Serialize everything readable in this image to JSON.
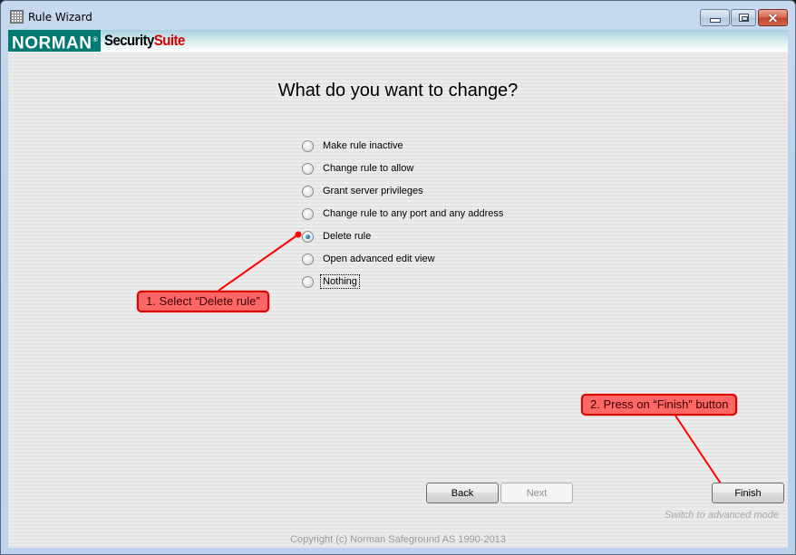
{
  "window": {
    "title": "Rule Wizard",
    "app_icon": "firewall-grid-icon",
    "controls": {
      "minimize": "minimize-icon",
      "maximize": "maximize-icon",
      "close": "close-icon"
    }
  },
  "brand": {
    "name": "NORMAN",
    "registered_mark": "®",
    "product_part1": "Security",
    "product_part2": "Suite",
    "colors": {
      "norman_bg": "#007a73",
      "suite_red": "#d90000"
    }
  },
  "wizard": {
    "title": "What do you want to change?",
    "options": [
      {
        "label": "Make rule inactive",
        "checked": false,
        "focused": false
      },
      {
        "label": "Change rule to allow",
        "checked": false,
        "focused": false
      },
      {
        "label": "Grant server privileges",
        "checked": false,
        "focused": false
      },
      {
        "label": "Change rule to any port and any address",
        "checked": false,
        "focused": false
      },
      {
        "label": "Delete rule",
        "checked": true,
        "focused": false
      },
      {
        "label": "Open advanced edit view",
        "checked": false,
        "focused": false
      },
      {
        "label": "Nothing",
        "checked": false,
        "focused": true
      }
    ],
    "selected": "Delete rule"
  },
  "annotations": {
    "step1": "1. Select “Delete rule”",
    "step2": "2. Press on “Finish” button",
    "color": "#ff0000"
  },
  "buttons": {
    "back": {
      "label": "Back",
      "enabled": true
    },
    "next": {
      "label": "Next",
      "enabled": false
    },
    "finish": {
      "label": "Finish",
      "enabled": true
    }
  },
  "footer": {
    "advanced_link": "Switch to advanced mode",
    "copyright": "Copyright (c) Norman Safeground AS 1990-2013"
  }
}
